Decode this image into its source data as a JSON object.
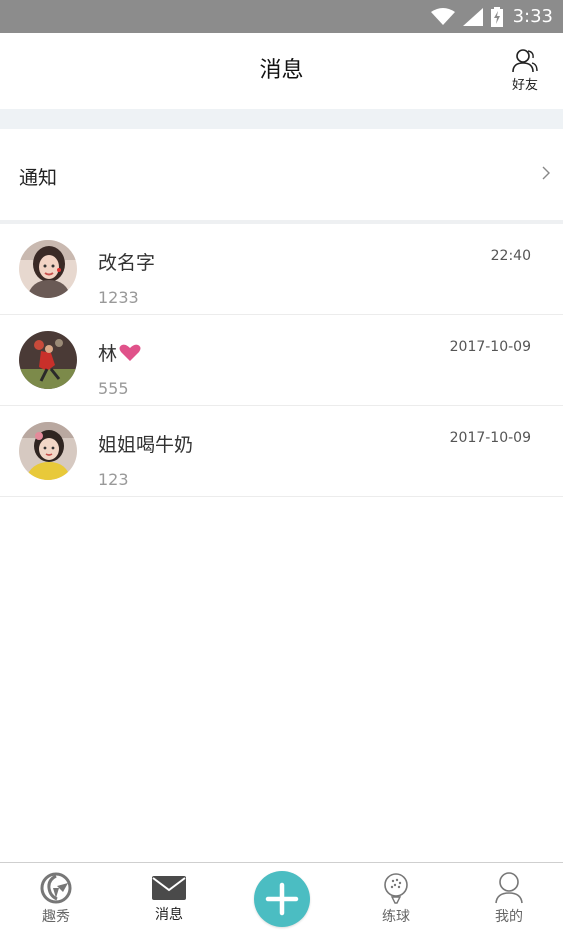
{
  "status_bar": {
    "time": "3:33",
    "icons": [
      "wifi-icon",
      "cell-signal-icon",
      "battery-charging-icon"
    ]
  },
  "header": {
    "title": "消息",
    "friends_label": "好友",
    "friends_icon": "friends-icon"
  },
  "notice": {
    "label": "通知",
    "icon": "chevron-right-icon"
  },
  "messages": [
    {
      "name": "改名字",
      "time": "22:40",
      "preview": "1233",
      "has_heart": false
    },
    {
      "name": "林",
      "time": "2017-10-09",
      "preview": "555",
      "has_heart": true
    },
    {
      "name": "姐姐喝牛奶",
      "time": "2017-10-09",
      "preview": "123",
      "has_heart": false
    }
  ],
  "tab_bar": {
    "tabs": [
      {
        "label": "趣秀",
        "icon": "show-icon",
        "active": false
      },
      {
        "label": "消息",
        "icon": "mail-icon",
        "active": true
      },
      {
        "label": "练球",
        "icon": "golf-ball-icon",
        "active": false
      },
      {
        "label": "我的",
        "icon": "person-icon",
        "active": false
      }
    ],
    "add_icon": "plus-icon"
  },
  "colors": {
    "accent": "#4bbdc2",
    "heart": "#e0528a",
    "status_bar": "#8c8c8c",
    "section_gap": "#eef2f5"
  }
}
